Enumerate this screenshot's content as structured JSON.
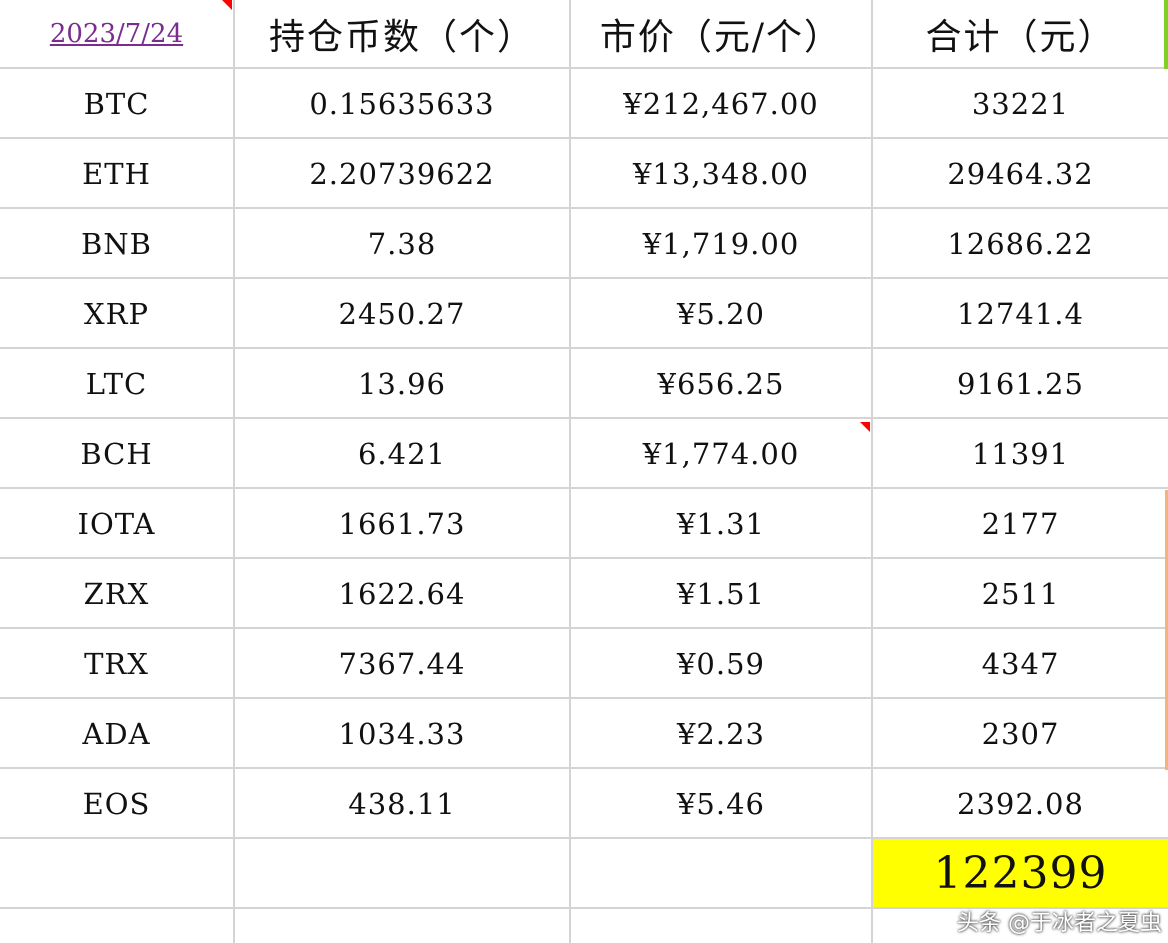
{
  "header": {
    "date": "2023/7/24",
    "col_amount": "持仓币数（个）",
    "col_price": "市价（元/个）",
    "col_total": "合计（元）"
  },
  "rows": [
    {
      "coin": "BTC",
      "amount": "0.15635633",
      "price": "¥212,467.00",
      "total": "33221"
    },
    {
      "coin": "ETH",
      "amount": "2.20739622",
      "price": "¥13,348.00",
      "total": "29464.32"
    },
    {
      "coin": "BNB",
      "amount": "7.38",
      "price": "¥1,719.00",
      "total": "12686.22"
    },
    {
      "coin": "XRP",
      "amount": "2450.27",
      "price": "¥5.20",
      "total": "12741.4"
    },
    {
      "coin": "LTC",
      "amount": "13.96",
      "price": "¥656.25",
      "total": "9161.25"
    },
    {
      "coin": "BCH",
      "amount": "6.421",
      "price": "¥1,774.00",
      "total": "11391"
    },
    {
      "coin": "IOTA",
      "amount": "1661.73",
      "price": "¥1.31",
      "total": "2177"
    },
    {
      "coin": "ZRX",
      "amount": "1622.64",
      "price": "¥1.51",
      "total": "2511"
    },
    {
      "coin": "TRX",
      "amount": "7367.44",
      "price": "¥0.59",
      "total": "4347"
    },
    {
      "coin": "ADA",
      "amount": "1034.33",
      "price": "¥2.23",
      "total": "2307"
    },
    {
      "coin": "EOS",
      "amount": "438.11",
      "price": "¥5.46",
      "total": "2392.08"
    }
  ],
  "grand_total": "122399",
  "watermark": "头条 @于冰者之夏虫",
  "colors": {
    "highlight": "#ffff00",
    "link": "#7b2c91",
    "gridline": "#d4d4d4",
    "comment_marker": "#ff0000"
  }
}
